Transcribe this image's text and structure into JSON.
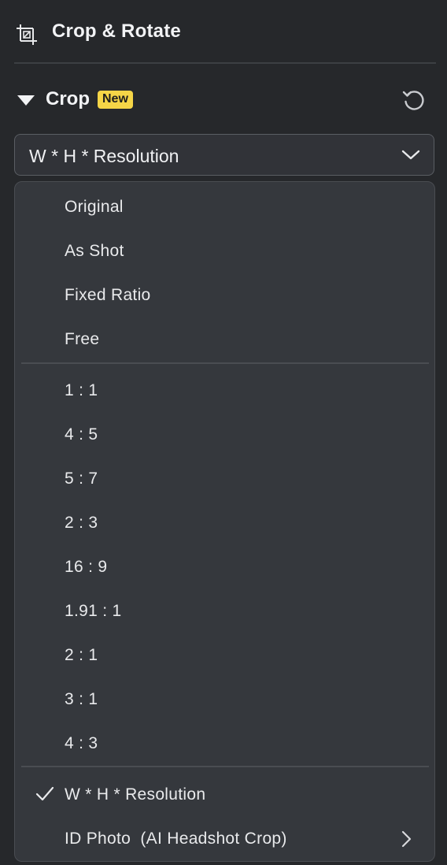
{
  "header": {
    "icon": "crop-icon",
    "title": "Crop & Rotate"
  },
  "section": {
    "title": "Crop",
    "badge": "New",
    "reset_icon": "reset-icon"
  },
  "crop_select": {
    "value": "W * H * Resolution",
    "icon": "chevron-down-icon"
  },
  "menu": {
    "group1": [
      {
        "label": "Original"
      },
      {
        "label": "As Shot"
      },
      {
        "label": "Fixed Ratio"
      },
      {
        "label": "Free"
      }
    ],
    "group2": [
      {
        "label": "1 : 1"
      },
      {
        "label": "4 : 5"
      },
      {
        "label": "5 : 7"
      },
      {
        "label": "2 : 3"
      },
      {
        "label": "16 : 9"
      },
      {
        "label": "1.91 : 1"
      },
      {
        "label": "2 : 1"
      },
      {
        "label": "3 : 1"
      },
      {
        "label": "4 : 3"
      }
    ],
    "group3": [
      {
        "label": "W * H * Resolution",
        "selected": true,
        "icon": "check-icon"
      },
      {
        "label": "ID Photo  (AI Headshot Crop)",
        "submenu": true,
        "icon": "chevron-right-icon"
      }
    ]
  },
  "colors": {
    "background": "#26282b",
    "menu_background": "#35383d",
    "badge": "#f5d547"
  }
}
